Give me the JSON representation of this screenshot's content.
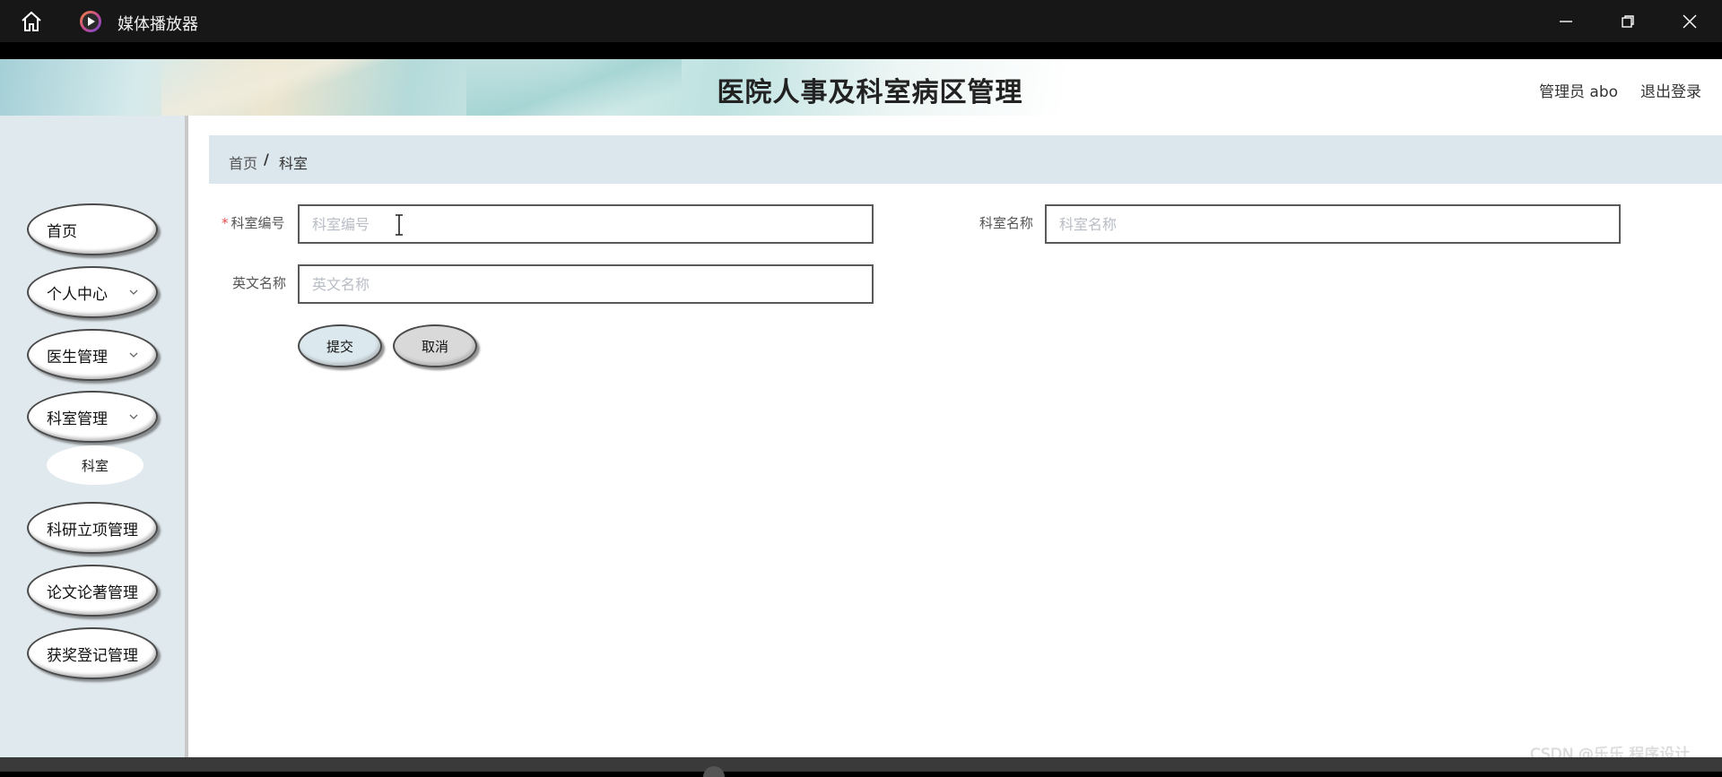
{
  "window": {
    "title": "媒体播放器",
    "icons": [
      "home-icon",
      "media-player-icon",
      "minimize-icon",
      "restore-icon",
      "close-icon"
    ]
  },
  "header": {
    "title": "医院人事及科室病区管理",
    "user": "管理员 abo",
    "logout": "退出登录"
  },
  "sidebar": {
    "items": [
      {
        "label": "首页",
        "has_chevron": false
      },
      {
        "label": "个人中心",
        "has_chevron": true
      },
      {
        "label": "医生管理",
        "has_chevron": true
      },
      {
        "label": "科室管理",
        "has_chevron": true
      },
      {
        "label": "科研立项管理",
        "has_chevron": false
      },
      {
        "label": "论文论著管理",
        "has_chevron": false
      },
      {
        "label": "获奖登记管理",
        "has_chevron": false
      }
    ],
    "sub_item": {
      "label": "科室"
    }
  },
  "breadcrumb": {
    "home": "首页",
    "separator": "/",
    "current": "科室"
  },
  "form": {
    "dept_code": {
      "label": "科室编号",
      "required_mark": "*",
      "placeholder": "科室编号",
      "value": ""
    },
    "dept_name": {
      "label": "科室名称",
      "placeholder": "科室名称",
      "value": ""
    },
    "english_name": {
      "label": "英文名称",
      "placeholder": "英文名称",
      "value": ""
    },
    "submit_label": "提交",
    "cancel_label": "取消"
  },
  "watermark": "CSDN @乐乐 程序设计",
  "colors": {
    "sidebar_bg": "#e0e9ee",
    "breadcrumb_bg": "#dbe7ec",
    "required": "#e34a4a",
    "titlebar_bg": "#171717"
  }
}
